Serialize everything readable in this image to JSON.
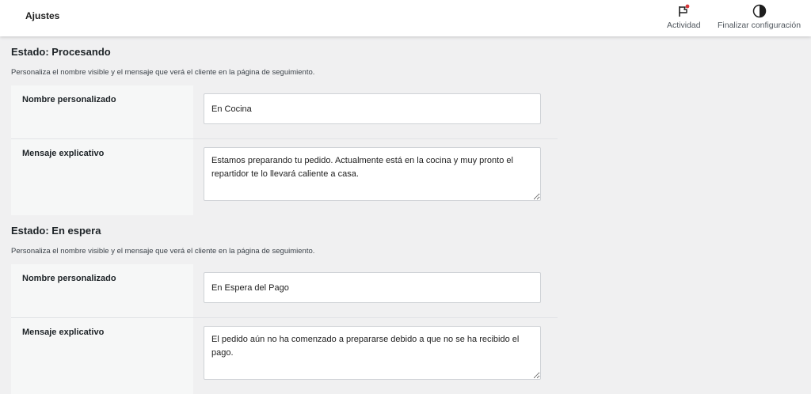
{
  "topbar": {
    "title": "Ajustes",
    "activity_label": "Actividad",
    "finish_label": "Finalizar configuración",
    "activity_icon": "flag-icon",
    "finish_icon": "half-circle-icon",
    "notification_color": "#d63638"
  },
  "sections": [
    {
      "title": "Estado: Procesando",
      "description": "Personaliza el nombre visible y el mensaje que verá el cliente en la página de seguimiento.",
      "name_label": "Nombre personalizado",
      "name_value": "En Cocina",
      "message_label": "Mensaje explicativo",
      "message_value": "Estamos preparando tu pedido. Actualmente está en la cocina y muy pronto el repartidor te lo llevará caliente a casa."
    },
    {
      "title": "Estado: En espera",
      "description": "Personaliza el nombre visible y el mensaje que verá el cliente en la página de seguimiento.",
      "name_label": "Nombre personalizado",
      "name_value": "En Espera del Pago",
      "message_label": "Mensaje explicativo",
      "message_value": "El pedido aún no ha comenzado a prepararse debido a que no se ha recibido el pago."
    }
  ]
}
